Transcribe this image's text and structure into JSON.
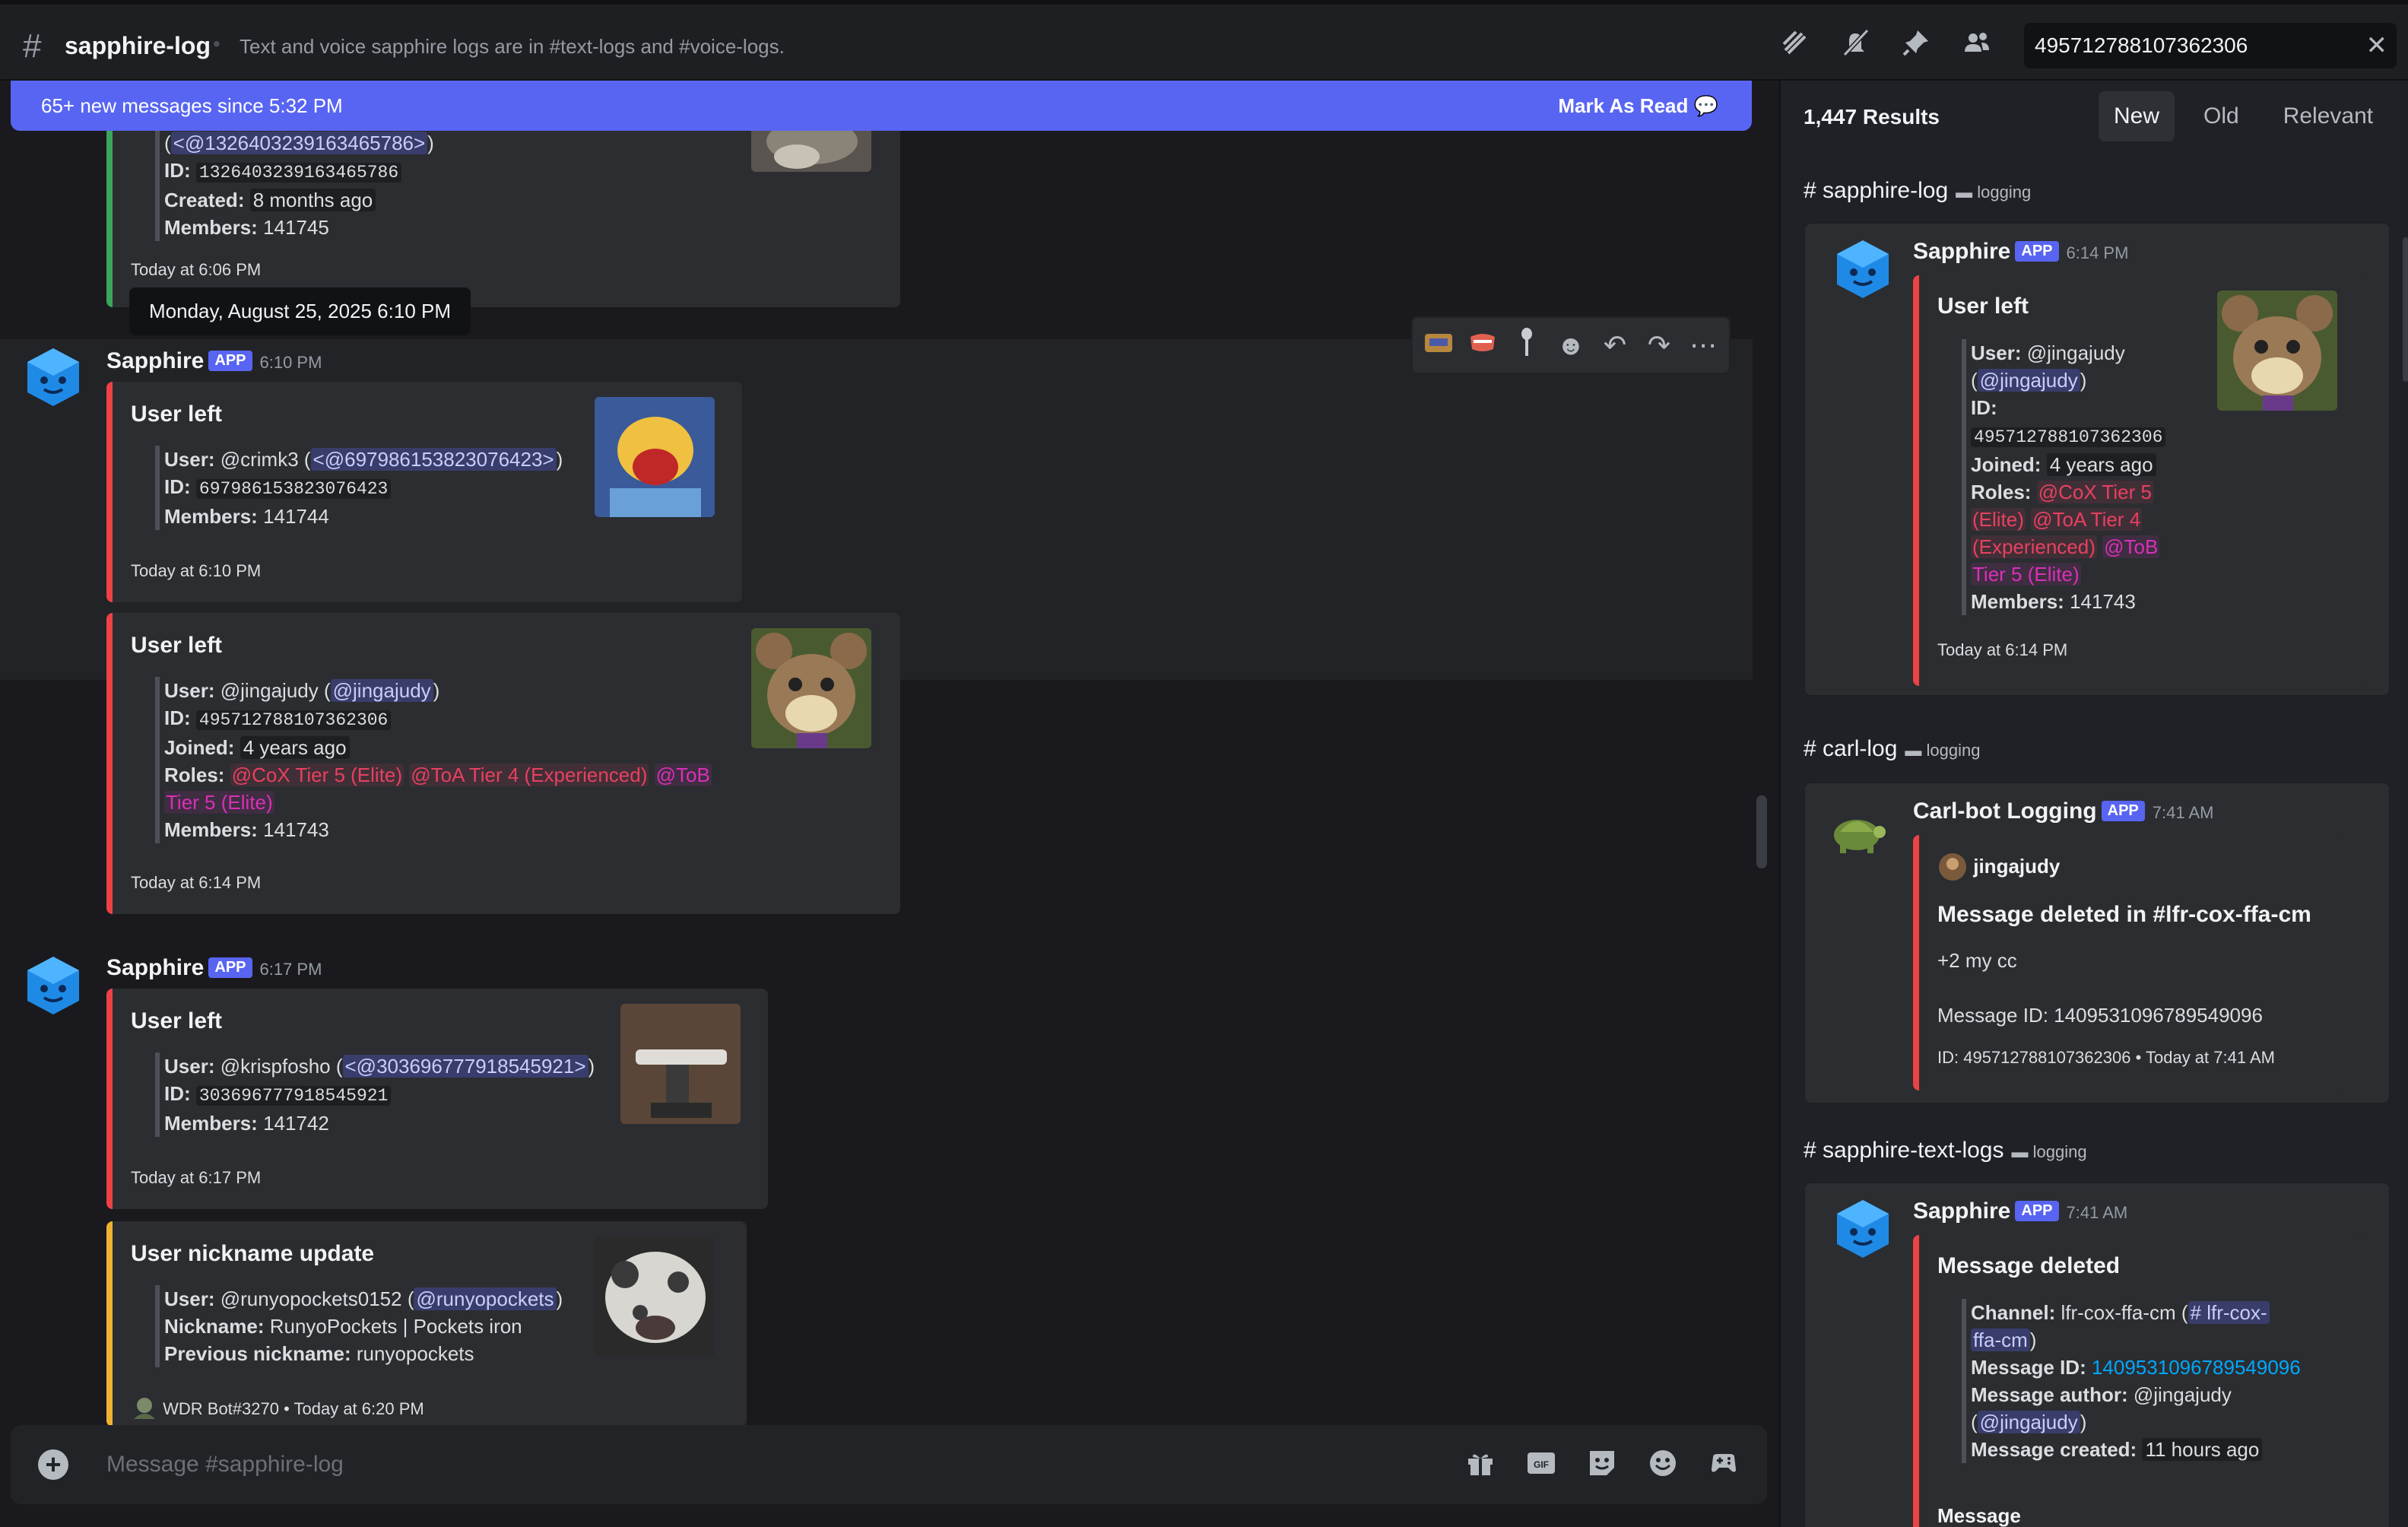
{
  "header": {
    "channel_name": "sapphire-log",
    "topic": "Text and voice sapphire logs are in #text-logs and #voice-logs.",
    "icons": [
      "threads-icon",
      "mute-icon",
      "pin-icon",
      "members-icon"
    ],
    "search_value": "495712788107362306"
  },
  "new_messages_bar": {
    "text": "65+ new messages since 5:32 PM",
    "action": "Mark As Read"
  },
  "tooltip": "Monday, August 25, 2025 6:10 PM",
  "messages": {
    "top_embed": {
      "mention": "<@1326403239163465786>",
      "id_label": "ID:",
      "id_value": "1326403239163465786",
      "created_label": "Created:",
      "created_value": "8 months ago",
      "members_label": "Members:",
      "members_value": "141745",
      "footer": "Today at 6:06 PM"
    },
    "group1": {
      "author": "Sapphire",
      "badge": "APP",
      "time": "6:10 PM",
      "embed1": {
        "title": "User left",
        "user_label": "User:",
        "user_value": "@crimk3 (",
        "mention": "<@697986153823076423>",
        "close": ")",
        "id_label": "ID:",
        "id_value": "697986153823076423",
        "members_label": "Members:",
        "members_value": "141744",
        "footer": "Today at 6:10 PM"
      },
      "embed2": {
        "title": "User left",
        "user_label": "User:",
        "user_value": "@jingajudy (",
        "mention": "@jingajudy",
        "close": ")",
        "id_label": "ID:",
        "id_value": "495712788107362306",
        "joined_label": "Joined:",
        "joined_value": "4 years ago",
        "roles_label": "Roles:",
        "role1": "@CoX Tier 5 (Elite)",
        "role2": "@ToA Tier 4 (Experienced)",
        "role3a": "@ToB",
        "role3b": "Tier 5 (Elite)",
        "members_label": "Members:",
        "members_value": "141743",
        "footer": "Today at 6:14 PM"
      }
    },
    "group2": {
      "author": "Sapphire",
      "badge": "APP",
      "time": "6:17 PM",
      "embed1": {
        "title": "User left",
        "user_label": "User:",
        "user_value": "@krispfosho (",
        "mention": "<@303696777918545921>",
        "close": ")",
        "id_label": "ID:",
        "id_value": "303696777918545921",
        "members_label": "Members:",
        "members_value": "141742",
        "footer": "Today at 6:17 PM"
      },
      "embed2": {
        "title": "User nickname update",
        "user_label": "User:",
        "user_value": "@runyopockets0152 (",
        "mention": "@runyopockets",
        "close": ")",
        "nick_label": "Nickname:",
        "nick_value": "RunyoPockets | Pockets iron",
        "prev_label": "Previous nickname:",
        "prev_value": "runyopockets",
        "footer": "WDR Bot#3270 • Today at 6:20 PM"
      }
    }
  },
  "composer": {
    "placeholder": "Message #sapphire-log",
    "icons": [
      "gift-icon",
      "gif-icon",
      "sticker-icon",
      "emoji-icon",
      "apps-icon"
    ]
  },
  "search_panel": {
    "count": "1,447 Results",
    "sorts": [
      "New",
      "Old",
      "Relevant"
    ],
    "active_sort": "New",
    "results": [
      {
        "channel": "sapphire-log",
        "category": "logging",
        "author": "Sapphire",
        "badge": "APP",
        "time": "6:14 PM",
        "title": "User left",
        "user_label": "User:",
        "user_value": "@jingajudy",
        "mention": "@jingajudy",
        "id_label": "ID:",
        "id_value": "495712788107362306",
        "joined_label": "Joined:",
        "joined_value": "4 years ago",
        "roles_label": "Roles:",
        "role1a": "@CoX Tier 5",
        "role1b": "(Elite)",
        "role2a": "@ToA Tier 4",
        "role2b": "(Experienced)",
        "role3a": "@ToB",
        "role3b": "Tier 5 (Elite)",
        "members_label": "Members:",
        "members_value": "141743",
        "footer": "Today at 6:14 PM"
      },
      {
        "channel": "carl-log",
        "category": "logging",
        "author": "Carl-bot Logging",
        "badge": "APP",
        "time": "7:41 AM",
        "embed_author": "jingajudy",
        "title": "Message deleted in #lfr-cox-ffa-cm",
        "content": "+2 my cc",
        "msgid": "Message ID: 1409531096789549096",
        "footer": "ID: 495712788107362306 • Today at 7:41 AM"
      },
      {
        "channel": "sapphire-text-logs",
        "category": "logging",
        "author": "Sapphire",
        "badge": "APP",
        "time": "7:41 AM",
        "title": "Message deleted",
        "channel_label": "Channel:",
        "channel_value": "lfr-cox-ffa-cm (",
        "channel_mention_a": "# lfr-cox-",
        "channel_mention_b": "ffa-cm",
        "msgid_label": "Message ID:",
        "msgid_value": "1409531096789549096",
        "author_label": "Message author:",
        "author_value": "@jingajudy",
        "author_mention": "@jingajudy",
        "created_label": "Message created:",
        "created_value": "11 hours ago",
        "message_label": "Message"
      }
    ]
  }
}
